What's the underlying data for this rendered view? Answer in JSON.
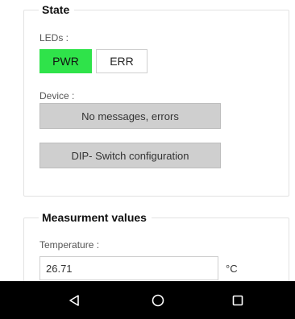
{
  "state": {
    "legend": "State",
    "leds_label": "LEDs :",
    "leds": [
      {
        "label": "PWR",
        "active": true,
        "color": "#2fe34a"
      },
      {
        "label": "ERR",
        "active": false,
        "color": "#ffffff"
      }
    ],
    "device_label": "Device :",
    "device_status": "No messages, errors",
    "dip_switch_button": "DIP- Switch configuration"
  },
  "measurement": {
    "legend": "Measurment values",
    "temperature_label": "Temperature :",
    "temperature_value": "26.71",
    "temperature_unit": "°C"
  },
  "navbar": {
    "buttons": [
      "back-icon",
      "home-icon",
      "recents-icon"
    ],
    "background": "#000000"
  }
}
